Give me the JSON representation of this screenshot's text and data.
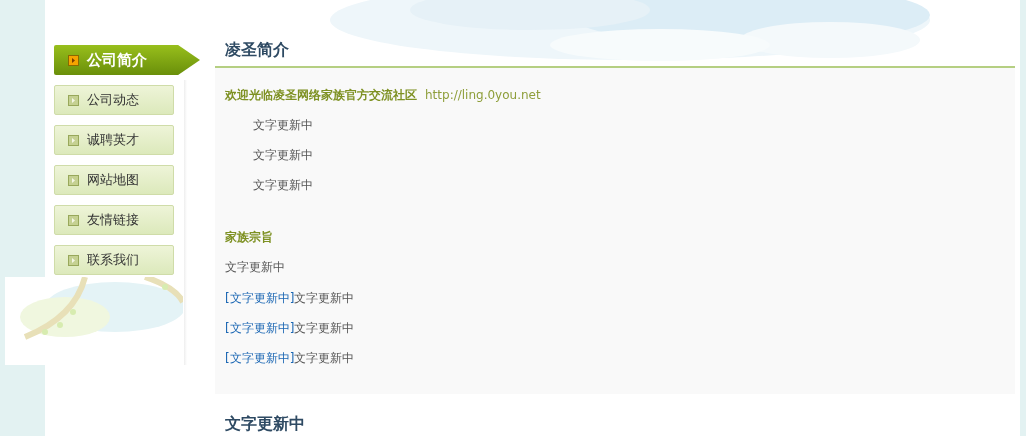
{
  "menu": [
    {
      "label": "公司简介",
      "selected": true
    },
    {
      "label": "公司动态",
      "selected": false
    },
    {
      "label": "诚聘英才",
      "selected": false
    },
    {
      "label": "网站地图",
      "selected": false
    },
    {
      "label": "友情链接",
      "selected": false
    },
    {
      "label": "联系我们",
      "selected": false
    }
  ],
  "section": {
    "title": "凌圣简介",
    "welcome": {
      "text": "欢迎光临凌圣网络家族官方交流社区",
      "url": "http://ling.0you.net"
    },
    "lines": [
      "文字更新中",
      "文字更新中",
      "文字更新中"
    ],
    "subtitle": "家族宗旨",
    "paragraph": "文字更新中",
    "links": [
      {
        "link": "[文字更新中]",
        "text": "文字更新中"
      },
      {
        "link": "[文字更新中]",
        "text": "文字更新中"
      },
      {
        "link": "[文字更新中]",
        "text": "文字更新中"
      }
    ]
  },
  "next_title": "文字更新中"
}
